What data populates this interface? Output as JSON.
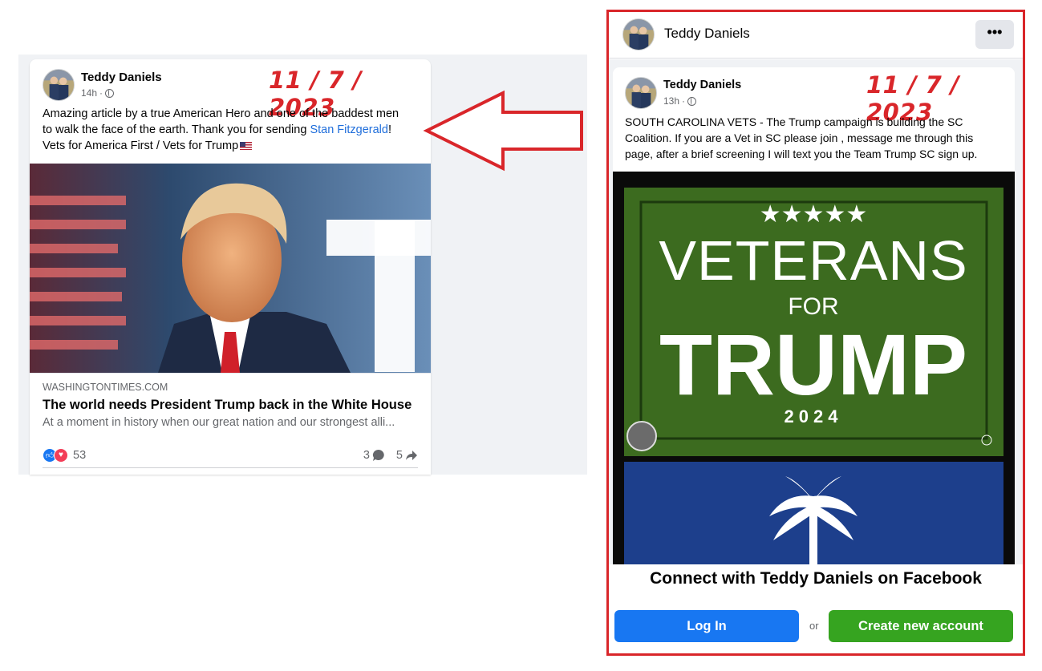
{
  "left_post": {
    "author": "Teddy Daniels",
    "time": "14h",
    "date_stamp": "11 / 7 / 2023",
    "text_line1": "Amazing article by a true American Hero and one of the baddest men",
    "text_line2_before": "to walk the face of the earth.  Thank you for sending ",
    "text_link": "Stan Fitzgerald",
    "text_line2_after": "!",
    "text_line3": "Vets for America First / Vets for Trump",
    "link_preview": {
      "domain": "WASHINGTONTIMES.COM",
      "title": "The world needs President Trump back in the White House",
      "description": "At a moment in history when our great nation and our strongest alli..."
    },
    "reaction_count": "53",
    "comment_count": "3",
    "share_count": "5"
  },
  "right_post": {
    "header_name": "Teddy Daniels",
    "more_label": "•••",
    "author": "Teddy Daniels",
    "time": "13h",
    "date_stamp": "11 / 7 / 2023",
    "text_line1": "SOUTH CAROLINA VETS - The Trump campaign is building the SC",
    "text_line2": "Coalition.  If you are a Vet in SC please join , message me through this",
    "text_line3": "page, after a brief screening I will text you the Team Trump SC sign up.",
    "poster": {
      "stars": "★★★★★",
      "line1": "VETERANS",
      "line2": "FOR",
      "line3": "TRUMP",
      "year": "2024"
    }
  },
  "login_prompt": {
    "title": "Connect with Teddy Daniels on Facebook",
    "login_label": "Log In",
    "or_label": "or",
    "create_label": "Create new account"
  },
  "colors": {
    "annotation_red": "#d9262a",
    "facebook_blue": "#1877f2",
    "create_green": "#36a420",
    "poster_green": "#3c6b1f",
    "poster_blue": "#1d3f8c"
  },
  "icons": [
    "globe-icon",
    "like-reaction-icon",
    "love-reaction-icon",
    "comment-icon",
    "share-icon",
    "more-options-icon",
    "flag-emoji"
  ]
}
